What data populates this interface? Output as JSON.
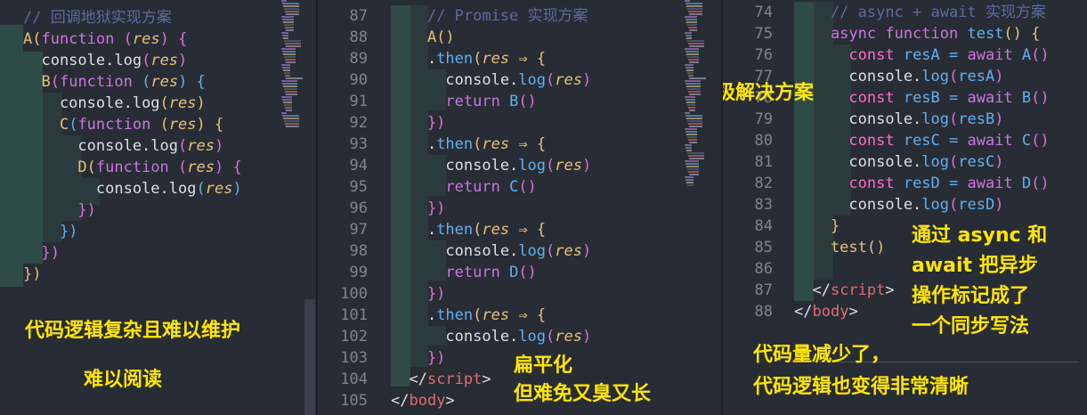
{
  "panels": {
    "left": {
      "lines": [
        [
          {
            "t": "// ",
            "c": "c-comment"
          },
          {
            "t": "回调地狱实现方案",
            "c": "c-comment"
          }
        ],
        [
          {
            "t": "A",
            "c": "c-fn"
          },
          {
            "t": "(",
            "c": "c-paren"
          },
          {
            "t": "function ",
            "c": "c-kw"
          },
          {
            "t": "(",
            "c": "c-paren2"
          },
          {
            "t": "res",
            "c": "c-param"
          },
          {
            "t": ") {",
            "c": "c-paren2"
          }
        ],
        [
          {
            "t": "  console.",
            "c": "c-plain"
          },
          {
            "t": "log",
            "c": "c-plain"
          },
          {
            "t": "(",
            "c": "c-paren2"
          },
          {
            "t": "res",
            "c": "c-param"
          },
          {
            "t": ")",
            "c": "c-paren2"
          }
        ],
        [
          {
            "t": "  B",
            "c": "c-fn"
          },
          {
            "t": "(",
            "c": "c-paren2"
          },
          {
            "t": "function ",
            "c": "c-kw"
          },
          {
            "t": "(",
            "c": "c-paren3"
          },
          {
            "t": "res",
            "c": "c-param"
          },
          {
            "t": ") {",
            "c": "c-paren3"
          }
        ],
        [
          {
            "t": "    console.",
            "c": "c-plain"
          },
          {
            "t": "log",
            "c": "c-plain"
          },
          {
            "t": "(",
            "c": "c-paren"
          },
          {
            "t": "res",
            "c": "c-param"
          },
          {
            "t": ")",
            "c": "c-paren"
          }
        ],
        [
          {
            "t": "    C",
            "c": "c-fn"
          },
          {
            "t": "(",
            "c": "c-paren3"
          },
          {
            "t": "function ",
            "c": "c-kw"
          },
          {
            "t": "(",
            "c": "c-paren"
          },
          {
            "t": "res",
            "c": "c-param"
          },
          {
            "t": ") {",
            "c": "c-paren"
          }
        ],
        [
          {
            "t": "      console.",
            "c": "c-plain"
          },
          {
            "t": "log",
            "c": "c-plain"
          },
          {
            "t": "(",
            "c": "c-paren2"
          },
          {
            "t": "res",
            "c": "c-param"
          },
          {
            "t": ")",
            "c": "c-paren2"
          }
        ],
        [
          {
            "t": "      D",
            "c": "c-fn"
          },
          {
            "t": "(",
            "c": "c-paren"
          },
          {
            "t": "function ",
            "c": "c-kw"
          },
          {
            "t": "(",
            "c": "c-paren2"
          },
          {
            "t": "res",
            "c": "c-param"
          },
          {
            "t": ") {",
            "c": "c-paren2"
          }
        ],
        [
          {
            "t": "        console.",
            "c": "c-plain"
          },
          {
            "t": "log",
            "c": "c-plain"
          },
          {
            "t": "(",
            "c": "c-paren3"
          },
          {
            "t": "res",
            "c": "c-param"
          },
          {
            "t": ")",
            "c": "c-paren3"
          }
        ],
        [
          {
            "t": "      })",
            "c": "c-paren2"
          }
        ],
        [
          {
            "t": "    })",
            "c": "c-paren3"
          }
        ],
        [
          {
            "t": "  })",
            "c": "c-paren2"
          }
        ],
        [
          {
            "t": "})",
            "c": "c-paren"
          }
        ]
      ],
      "annotations": [
        "代码逻辑复杂且难以维护",
        "难以阅读"
      ]
    },
    "middle": {
      "line_numbers": [
        "87",
        "88",
        "89",
        "90",
        "91",
        "92",
        "93",
        "94",
        "95",
        "96",
        "97",
        "98",
        "99",
        "100",
        "101",
        "102",
        "103",
        "104",
        "105"
      ],
      "lines": [
        [
          {
            "t": "    // Promise ",
            "c": "c-comment"
          },
          {
            "t": "实现方案",
            "c": "c-comment"
          }
        ],
        [
          {
            "t": "    A",
            "c": "c-fn"
          },
          {
            "t": "()",
            "c": "c-paren"
          }
        ],
        [
          {
            "t": "    .",
            "c": "c-plain"
          },
          {
            "t": "then",
            "c": "c-method"
          },
          {
            "t": "(",
            "c": "c-paren"
          },
          {
            "t": "res",
            "c": "c-param"
          },
          {
            "t": " ⇒ {",
            "c": "c-paren"
          }
        ],
        [
          {
            "t": "      console.",
            "c": "c-plain"
          },
          {
            "t": "log",
            "c": "c-method"
          },
          {
            "t": "(",
            "c": "c-paren2"
          },
          {
            "t": "res",
            "c": "c-param"
          },
          {
            "t": ")",
            "c": "c-paren2"
          }
        ],
        [
          {
            "t": "      return ",
            "c": "c-ret"
          },
          {
            "t": "B",
            "c": "c-var"
          },
          {
            "t": "()",
            "c": "c-paren2"
          }
        ],
        [
          {
            "t": "    })",
            "c": "c-paren2"
          }
        ],
        [
          {
            "t": "    .",
            "c": "c-plain"
          },
          {
            "t": "then",
            "c": "c-method"
          },
          {
            "t": "(",
            "c": "c-paren"
          },
          {
            "t": "res",
            "c": "c-param"
          },
          {
            "t": " ⇒ {",
            "c": "c-paren"
          }
        ],
        [
          {
            "t": "      console.",
            "c": "c-plain"
          },
          {
            "t": "log",
            "c": "c-method"
          },
          {
            "t": "(",
            "c": "c-paren2"
          },
          {
            "t": "res",
            "c": "c-param"
          },
          {
            "t": ")",
            "c": "c-paren2"
          }
        ],
        [
          {
            "t": "      return ",
            "c": "c-ret"
          },
          {
            "t": "C",
            "c": "c-var"
          },
          {
            "t": "()",
            "c": "c-paren2"
          }
        ],
        [
          {
            "t": "    })",
            "c": "c-paren2"
          }
        ],
        [
          {
            "t": "    .",
            "c": "c-plain"
          },
          {
            "t": "then",
            "c": "c-method"
          },
          {
            "t": "(",
            "c": "c-paren"
          },
          {
            "t": "res",
            "c": "c-param"
          },
          {
            "t": " ⇒ {",
            "c": "c-paren"
          }
        ],
        [
          {
            "t": "      console.",
            "c": "c-plain"
          },
          {
            "t": "log",
            "c": "c-method"
          },
          {
            "t": "(",
            "c": "c-paren2"
          },
          {
            "t": "res",
            "c": "c-param"
          },
          {
            "t": ")",
            "c": "c-paren2"
          }
        ],
        [
          {
            "t": "      return ",
            "c": "c-ret"
          },
          {
            "t": "D",
            "c": "c-var"
          },
          {
            "t": "()",
            "c": "c-paren2"
          }
        ],
        [
          {
            "t": "    })",
            "c": "c-paren2"
          }
        ],
        [
          {
            "t": "    .",
            "c": "c-plain"
          },
          {
            "t": "then",
            "c": "c-method"
          },
          {
            "t": "(",
            "c": "c-paren"
          },
          {
            "t": "res",
            "c": "c-param"
          },
          {
            "t": " ⇒ {",
            "c": "c-paren"
          }
        ],
        [
          {
            "t": "      console.",
            "c": "c-plain"
          },
          {
            "t": "log",
            "c": "c-method"
          },
          {
            "t": "(",
            "c": "c-paren2"
          },
          {
            "t": "res",
            "c": "c-param"
          },
          {
            "t": ")",
            "c": "c-paren2"
          }
        ],
        [
          {
            "t": "    })",
            "c": "c-paren2"
          }
        ],
        [
          {
            "t": "  </",
            "c": "c-punct"
          },
          {
            "t": "script",
            "c": "c-tag"
          },
          {
            "t": ">",
            "c": "c-punct"
          }
        ],
        [
          {
            "t": "</",
            "c": "c-punct"
          },
          {
            "t": "body",
            "c": "c-tag"
          },
          {
            "t": ">",
            "c": "c-punct"
          }
        ]
      ],
      "annotations": [
        "扁平化",
        "但难免又臭又长"
      ]
    },
    "right": {
      "line_numbers": [
        "74",
        "75",
        "76",
        "77",
        "78",
        "79",
        "80",
        "81",
        "82",
        "83",
        "84",
        "85",
        "86",
        "87",
        "88"
      ],
      "lines": [
        [
          {
            "t": "    // async + await ",
            "c": "c-comment"
          },
          {
            "t": "实现方案",
            "c": "c-comment"
          }
        ],
        [
          {
            "t": "    async function ",
            "c": "c-kw"
          },
          {
            "t": "test",
            "c": "c-method"
          },
          {
            "t": "() {",
            "c": "c-paren"
          }
        ],
        [
          {
            "t": "      const ",
            "c": "c-const"
          },
          {
            "t": "resA = ",
            "c": "c-var"
          },
          {
            "t": "await ",
            "c": "c-kw"
          },
          {
            "t": "A",
            "c": "c-var"
          },
          {
            "t": "()",
            "c": "c-paren2"
          }
        ],
        [
          {
            "t": "      console.",
            "c": "c-plain"
          },
          {
            "t": "log",
            "c": "c-method"
          },
          {
            "t": "(",
            "c": "c-paren2"
          },
          {
            "t": "resA",
            "c": "c-var"
          },
          {
            "t": ")",
            "c": "c-paren2"
          }
        ],
        [
          {
            "t": "      const ",
            "c": "c-const"
          },
          {
            "t": "resB = ",
            "c": "c-var"
          },
          {
            "t": "await ",
            "c": "c-kw"
          },
          {
            "t": "B",
            "c": "c-var"
          },
          {
            "t": "()",
            "c": "c-paren2"
          }
        ],
        [
          {
            "t": "      console.",
            "c": "c-plain"
          },
          {
            "t": "log",
            "c": "c-method"
          },
          {
            "t": "(",
            "c": "c-paren2"
          },
          {
            "t": "resB",
            "c": "c-var"
          },
          {
            "t": ")",
            "c": "c-paren2"
          }
        ],
        [
          {
            "t": "      const ",
            "c": "c-const"
          },
          {
            "t": "resC = ",
            "c": "c-var"
          },
          {
            "t": "await ",
            "c": "c-kw"
          },
          {
            "t": "C",
            "c": "c-var"
          },
          {
            "t": "()",
            "c": "c-paren2"
          }
        ],
        [
          {
            "t": "      console.",
            "c": "c-plain"
          },
          {
            "t": "log",
            "c": "c-method"
          },
          {
            "t": "(",
            "c": "c-paren2"
          },
          {
            "t": "resC",
            "c": "c-var"
          },
          {
            "t": ")",
            "c": "c-paren2"
          }
        ],
        [
          {
            "t": "      const ",
            "c": "c-const"
          },
          {
            "t": "resD = ",
            "c": "c-var"
          },
          {
            "t": "await ",
            "c": "c-kw"
          },
          {
            "t": "D",
            "c": "c-var"
          },
          {
            "t": "()",
            "c": "c-paren2"
          }
        ],
        [
          {
            "t": "      console.",
            "c": "c-plain"
          },
          {
            "t": "log",
            "c": "c-method"
          },
          {
            "t": "(",
            "c": "c-paren2"
          },
          {
            "t": "resD",
            "c": "c-var"
          },
          {
            "t": ")",
            "c": "c-paren2"
          }
        ],
        [
          {
            "t": "    }",
            "c": "c-paren"
          }
        ],
        [
          {
            "t": "    test",
            "c": "c-fn"
          },
          {
            "t": "()",
            "c": "c-paren"
          }
        ],
        [
          {
            "t": "",
            "c": "c-plain"
          }
        ],
        [
          {
            "t": "  </",
            "c": "c-punct"
          },
          {
            "t": "script",
            "c": "c-tag"
          },
          {
            "t": ">",
            "c": "c-punct"
          }
        ],
        [
          {
            "t": "</",
            "c": "c-punct"
          },
          {
            "t": "body",
            "c": "c-tag"
          },
          {
            "t": ">",
            "c": "c-punct"
          }
        ]
      ],
      "annotations": [
        "终极解决方案",
        "通过 async 和",
        "await 把异步",
        "操作标记成了",
        "一个同步写法",
        "代码量减少了，",
        "代码逻辑也变得非常清晰"
      ]
    }
  },
  "colors": {
    "annotation": "#ffe600",
    "background": "#282c34"
  }
}
